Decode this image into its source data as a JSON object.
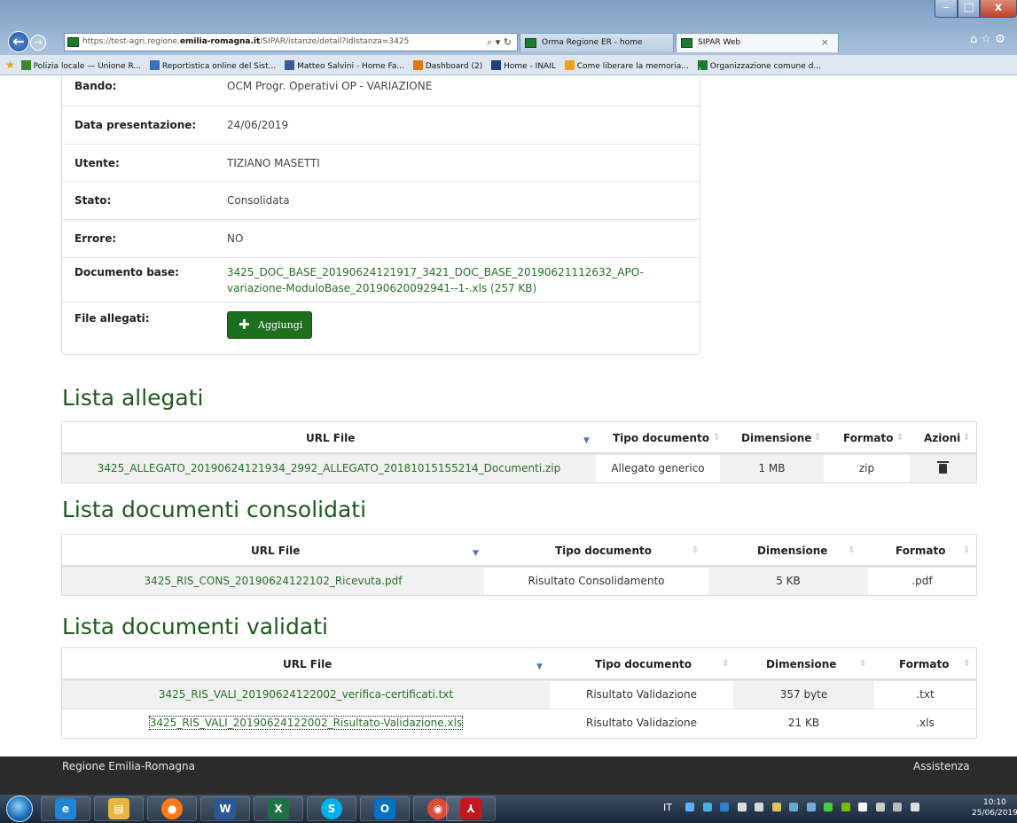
{
  "browser": {
    "url_prefix": "https://test-agri.regione.",
    "url_host": "emilia-romagna.it",
    "url_path": "/SIPAR/istanze/detail?idIstanza=3425",
    "search_refresh_glyphs": "⌕ ▾ ↻",
    "tabs": [
      {
        "label": "Orma Regione ER - home"
      },
      {
        "label": "SIPAR Web",
        "active": true
      }
    ],
    "tab_close": "×",
    "toolbar_glyphs": "⌂ ☆ ⚙",
    "window_controls": {
      "minimize": "–",
      "maximize": "□",
      "close": "x"
    },
    "favorites": [
      {
        "label": "Polizia locale — Unione R...",
        "icon_color": "#3a8a2a"
      },
      {
        "label": "Reportistica online del Sist...",
        "icon_color": "#3a6fbf"
      },
      {
        "label": "Matteo Salvini - Home Fa...",
        "icon_color": "#3b5998"
      },
      {
        "label": "Dashboard (2)",
        "icon_color": "#e07a10"
      },
      {
        "label": "Home - INAIL",
        "icon_color": "#1d3f7a"
      },
      {
        "label": "Come liberare la memoria...",
        "icon_color": "#f0a020"
      },
      {
        "label": "Organizzazione comune d...",
        "icon_color": "#1c7a2e"
      }
    ]
  },
  "detail": {
    "rows": [
      {
        "label": "Bando:",
        "value": "OCM Progr. Operativi OP - VARIAZIONE"
      },
      {
        "label": "Data presentazione:",
        "value": "24/06/2019"
      },
      {
        "label": "Utente:",
        "value": "TIZIANO MASETTI"
      },
      {
        "label": "Stato:",
        "value": "Consolidata"
      },
      {
        "label": "Errore:",
        "value": "NO"
      }
    ],
    "documento_base_label": "Documento base:",
    "documento_base_line1": "3425_DOC_BASE_20190624121917_3421_DOC_BASE_20190621112632_APO-",
    "documento_base_line2": "variazione-ModuloBase_20190620092941--1-.xls (257 KB)",
    "file_allegati_label": "File allegati:",
    "add_button_icon": "✚",
    "add_button_label": "Aggiungi"
  },
  "lista_allegati": {
    "title": "Lista allegati",
    "headers": {
      "url": "URL File",
      "tipo": "Tipo documento",
      "dim": "Dimensione",
      "formato": "Formato",
      "azioni": "Azioni"
    },
    "rows": [
      {
        "url": "3425_ALLEGATO_20190624121934_2992_ALLEGATO_20181015155214_Documenti.zip",
        "tipo": "Allegato generico",
        "dim": "1 MB",
        "formato": "zip"
      }
    ]
  },
  "lista_consolidati": {
    "title": "Lista documenti consolidati",
    "headers": {
      "url": "URL File",
      "tipo": "Tipo documento",
      "dim": "Dimensione",
      "formato": "Formato"
    },
    "rows": [
      {
        "url": "3425_RIS_CONS_20190624122102_Ricevuta.pdf",
        "tipo": "Risultato Consolidamento",
        "dim": "5 KB",
        "formato": ".pdf"
      }
    ]
  },
  "lista_validati": {
    "title": "Lista documenti validati",
    "headers": {
      "url": "URL File",
      "tipo": "Tipo documento",
      "dim": "Dimensione",
      "formato": "Formato"
    },
    "rows": [
      {
        "url": "3425_RIS_VALI_20190624122002_verifica-certificati.txt",
        "tipo": "Risultato Validazione",
        "dim": "357 byte",
        "formato": ".txt"
      },
      {
        "url": "3425_RIS_VALI_20190624122002_Risultato-Validazione.xls",
        "tipo": "Risultato Validazione",
        "dim": "21 KB",
        "formato": ".xls"
      }
    ]
  },
  "sort_glyphs": {
    "active": "▼",
    "inactive": "⇕"
  },
  "footer": {
    "left": "Regione Emilia-Romagna",
    "right": "Assistenza"
  },
  "taskbar": {
    "apps": [
      {
        "name": "ie-icon",
        "glyph": "e",
        "color": "#1e86d6"
      },
      {
        "name": "explorer-icon",
        "glyph": "▤",
        "color": "#e8b640"
      },
      {
        "name": "firefox-icon",
        "glyph": "●",
        "color": "#ff7a16"
      },
      {
        "name": "word-icon",
        "glyph": "W",
        "color": "#2b5797"
      },
      {
        "name": "excel-icon",
        "glyph": "X",
        "color": "#1f7244"
      },
      {
        "name": "skype-icon",
        "glyph": "S",
        "color": "#00aff0"
      },
      {
        "name": "outlook-icon",
        "glyph": "O",
        "color": "#0072c6"
      },
      {
        "name": "chrome-icon",
        "glyph": "◉",
        "color": "#dd4b39"
      },
      {
        "name": "acrobat-icon",
        "glyph": "⅄",
        "color": "#c4161c"
      }
    ],
    "lang": "IT",
    "time": "10:10",
    "date": "25/06/2019"
  }
}
